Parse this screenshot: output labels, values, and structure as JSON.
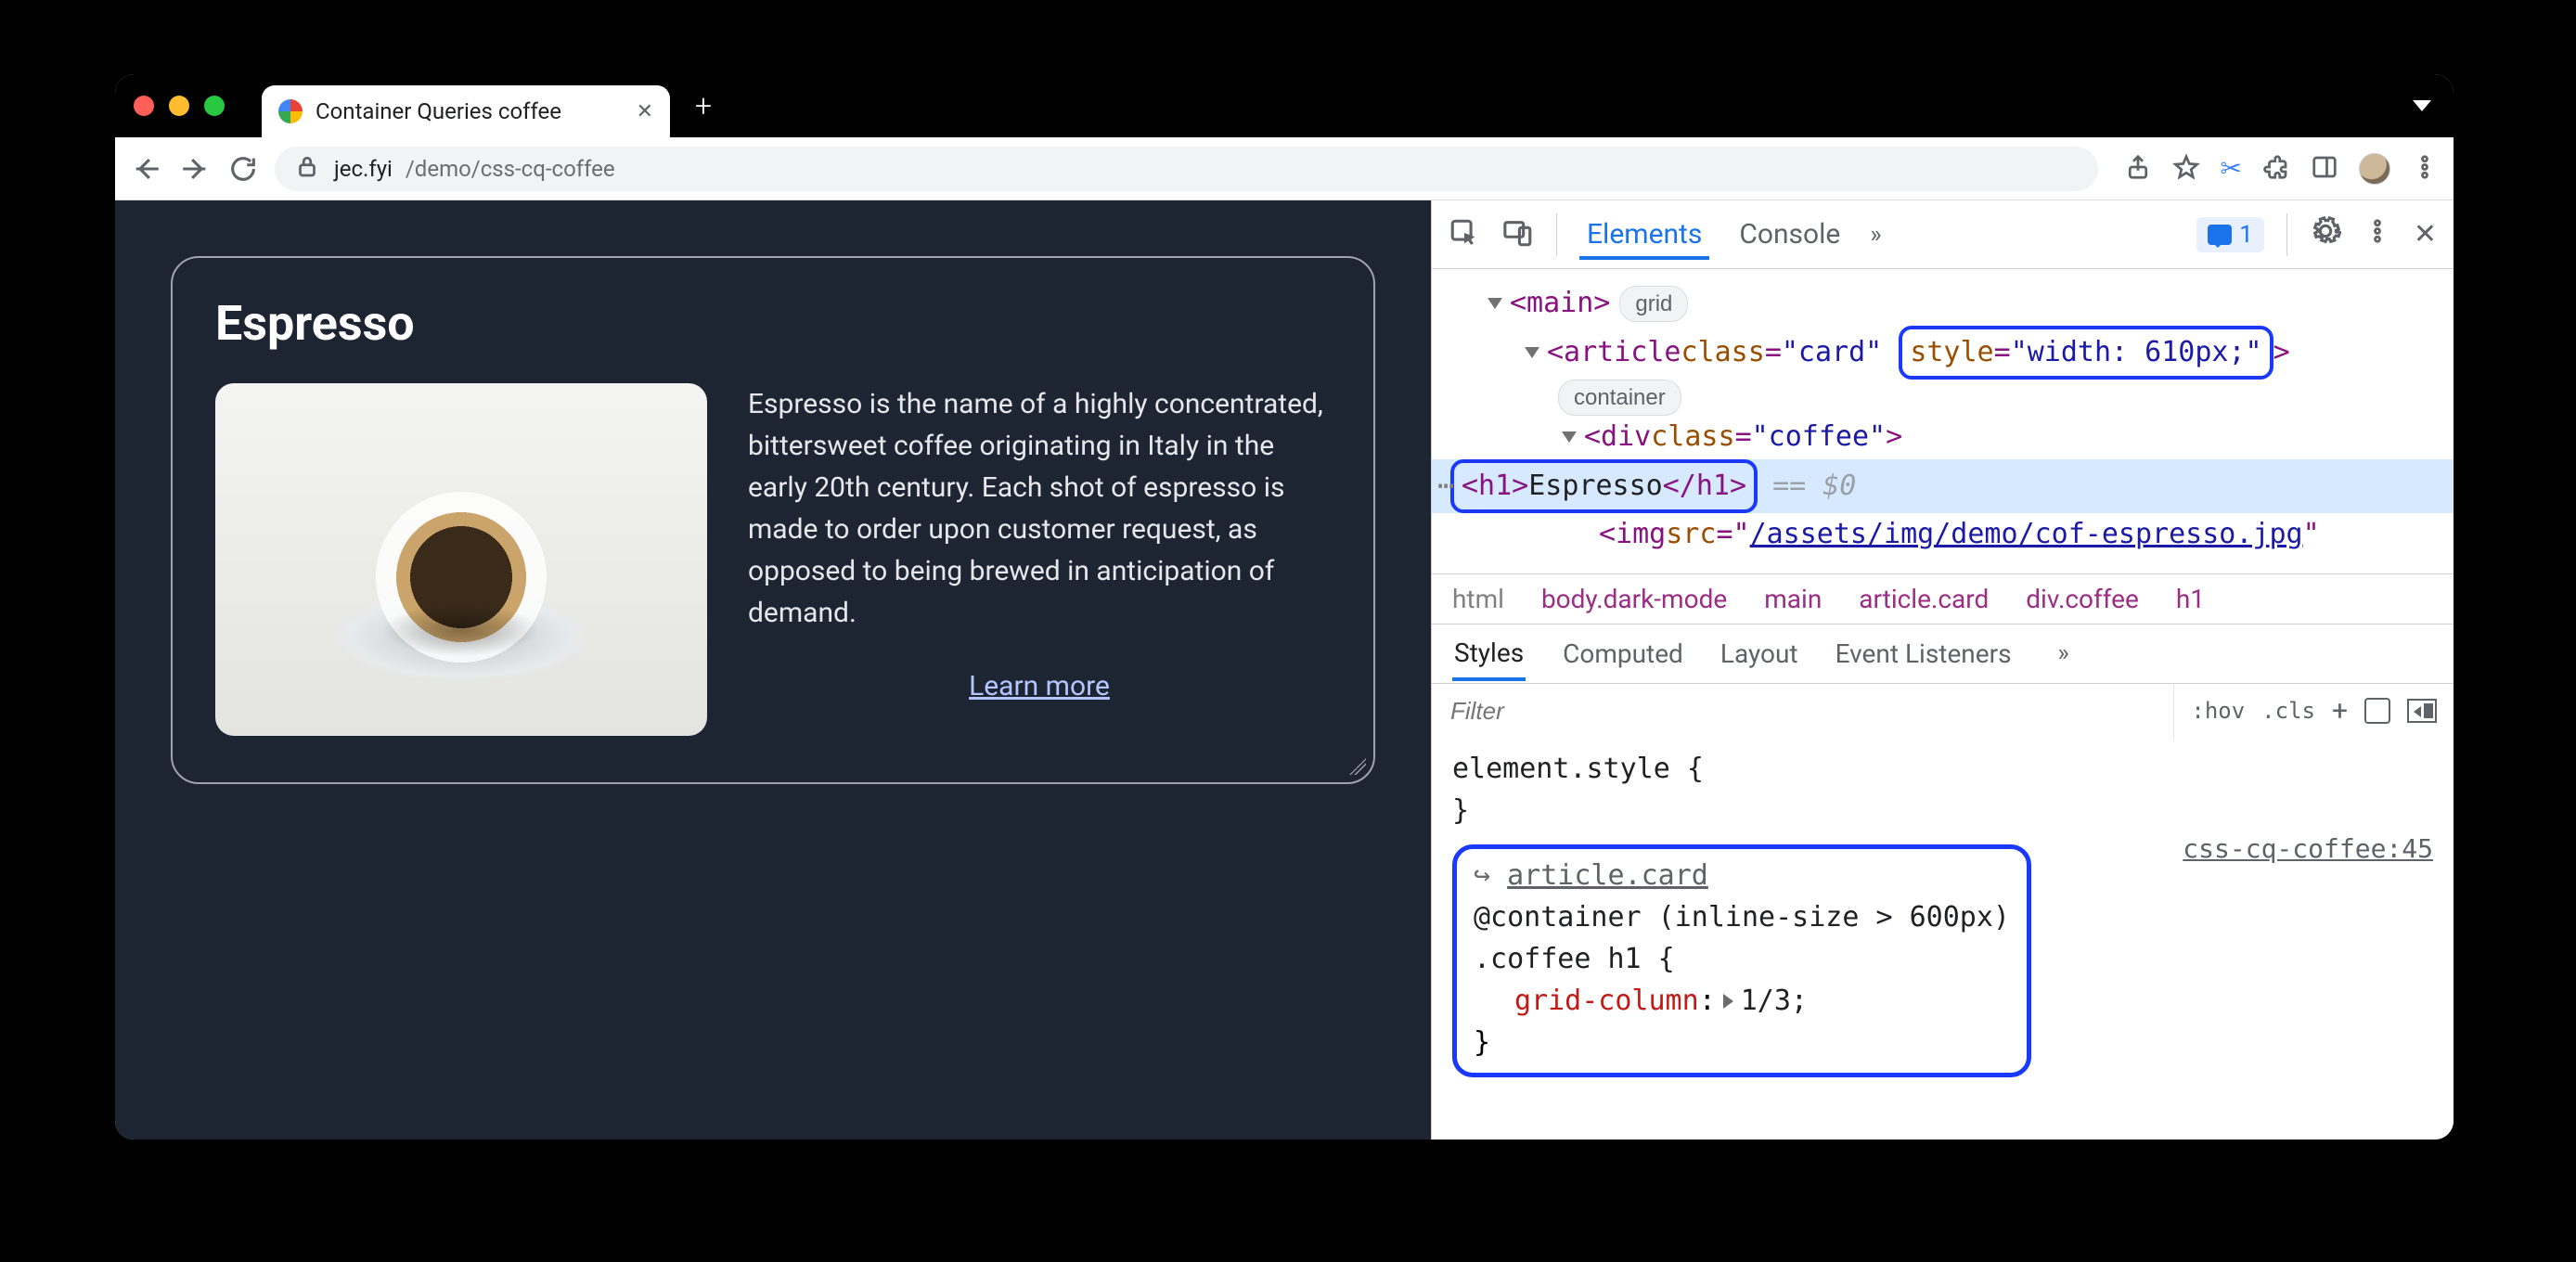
{
  "window": {
    "tab_title": "Container Queries coffee"
  },
  "toolbar": {
    "url_host": "jec.fyi",
    "url_path": "/demo/css-cq-coffee"
  },
  "page": {
    "heading": "Espresso",
    "paragraph": "Espresso is the name of a highly concentrated, bittersweet coffee originating in Italy in the early 20th century. Each shot of espresso is made to order upon customer request, as opposed to being brewed in anticipation of demand.",
    "learn_more": "Learn more"
  },
  "devtools": {
    "tabs": {
      "elements": "Elements",
      "console": "Console"
    },
    "issues_count": "1",
    "dom": {
      "main_tag": "<main>",
      "main_badge": "grid",
      "article_open": "<article ",
      "article_class_attr": "class",
      "article_class_val": "\"card\"",
      "article_style_attr": "style",
      "article_style_val": "\"width: 610px;\"",
      "article_close": ">",
      "article_badge": "container",
      "div_open": "<div ",
      "div_class_attr": "class",
      "div_class_val": "\"coffee\"",
      "div_close": ">",
      "h1_open": "<h1>",
      "h1_text": "Espresso",
      "h1_close": "</h1>",
      "eq_dollar": "== $0",
      "img_open": "<img ",
      "img_src_attr": "src",
      "img_src_val": "/assets/img/demo/cof-espresso.jpg",
      "img_close": "\""
    },
    "crumbs": [
      "html",
      "body.dark-mode",
      "main",
      "article.card",
      "div.coffee",
      "h1"
    ],
    "styles_tabs": {
      "styles": "Styles",
      "computed": "Computed",
      "layout": "Layout",
      "event": "Event Listeners"
    },
    "filter_placeholder": "Filter",
    "hov": ":hov",
    "cls": ".cls",
    "rule_element_style": "element.style {",
    "rule_element_style_close": "}",
    "cq": {
      "arrow": "↪",
      "link": "article.card",
      "at_rule": "@container (inline-size > 600px)",
      "selector": ".coffee h1 {",
      "prop": "grid-column",
      "colon": ":",
      "val": "1/3;",
      "close": "}",
      "source": "css-cq-coffee:45"
    }
  }
}
